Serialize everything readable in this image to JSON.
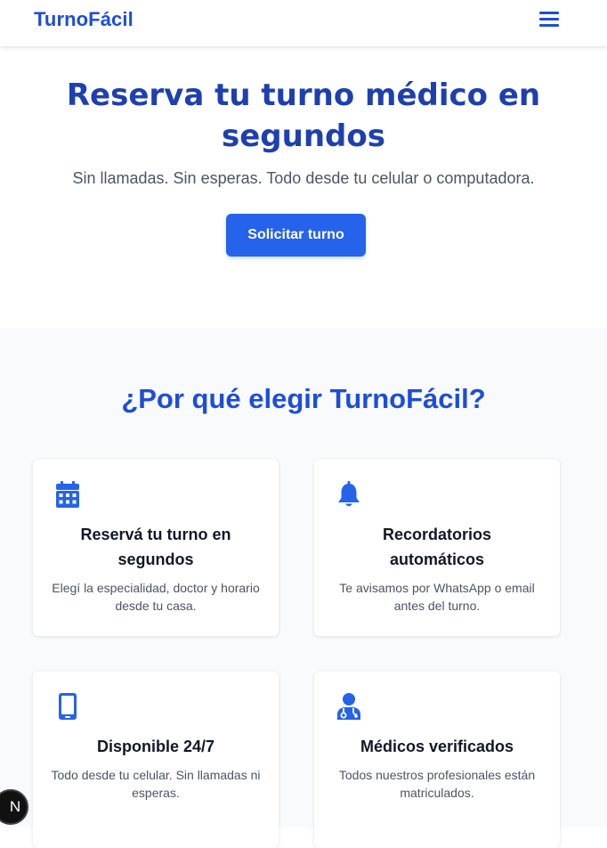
{
  "header": {
    "logo": "TurnoFácil",
    "menu_icon": "hamburger-menu-icon"
  },
  "hero": {
    "title": "Reserva tu turno médico en segundos",
    "subtitle": "Sin llamadas. Sin esperas. Todo desde tu celular o computadora.",
    "cta_label": "Solicitar turno"
  },
  "features": {
    "title": "¿Por qué elegir TurnoFácil?",
    "cards": [
      {
        "icon": "calendar-icon",
        "title": "Reservá tu turno en segundos",
        "text": "Elegí la especialidad, doctor y horario desde tu casa."
      },
      {
        "icon": "bell-icon",
        "title": "Recordatorios automáticos",
        "text": "Te avisamos por WhatsApp o email antes del turno."
      },
      {
        "icon": "mobile-phone-icon",
        "title": "Disponible 24/7",
        "text": "Todo desde tu celular. Sin llamadas ni esperas."
      },
      {
        "icon": "doctor-icon",
        "title": "Médicos verificados",
        "text": "Todos nuestros profesionales están matriculados."
      }
    ]
  },
  "dev_badge": {
    "letter": "N"
  },
  "colors": {
    "brand": "#1d4ed8",
    "button": "#2563eb",
    "icon": "#2563eb",
    "section_background": "#f8fafc"
  }
}
